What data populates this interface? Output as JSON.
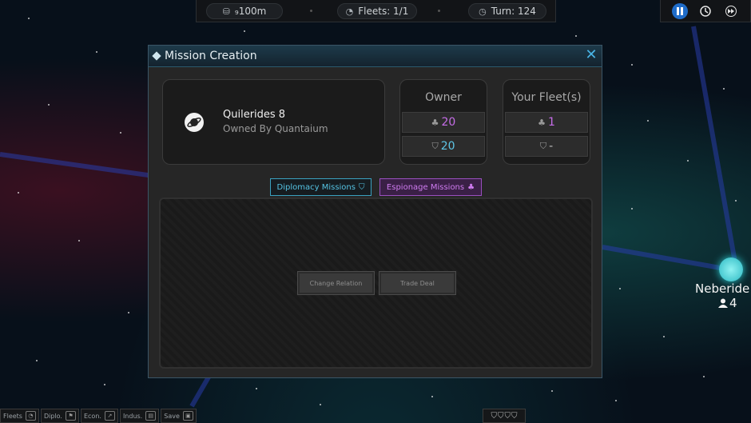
{
  "topbar": {
    "credits": {
      "icon": "credits-icon",
      "value": "₉100m"
    },
    "fleets": {
      "icon": "fleet-icon",
      "label": "Fleets: 1/1"
    },
    "turn": {
      "icon": "clock-icon",
      "label": "Turn: 124"
    }
  },
  "controls": [
    "pause-icon",
    "clock-icon",
    "fast-forward-icon"
  ],
  "modal": {
    "title": "Mission Creation",
    "planet": {
      "name": "Quilerides 8",
      "owner": "Owned By Quantaium"
    },
    "owner_card": {
      "title": "Owner",
      "espionage": "20",
      "diplomacy": "20"
    },
    "fleet_card": {
      "title": "Your Fleet(s)",
      "espionage": "1",
      "diplomacy": "-"
    },
    "tabs": {
      "diplomacy": "Diplomacy Missions",
      "espionage": "Espionage Missions"
    },
    "buttons": {
      "change_relation": "Change Relation",
      "trade_deal": "Trade Deal"
    }
  },
  "map": {
    "node_name": "Neberide",
    "node_population": "4"
  },
  "bottombar": [
    {
      "label": "Fleets",
      "icon": "fleet-icon"
    },
    {
      "label": "Diplo.",
      "icon": "flag-icon"
    },
    {
      "label": "Econ.",
      "icon": "chart-icon"
    },
    {
      "label": "Indus.",
      "icon": "factory-icon"
    },
    {
      "label": "Save",
      "icon": "save-icon"
    }
  ],
  "colors": {
    "accent": "#49b4e6",
    "espionage": "#c66de8",
    "diplomacy": "#5ec6e6"
  }
}
